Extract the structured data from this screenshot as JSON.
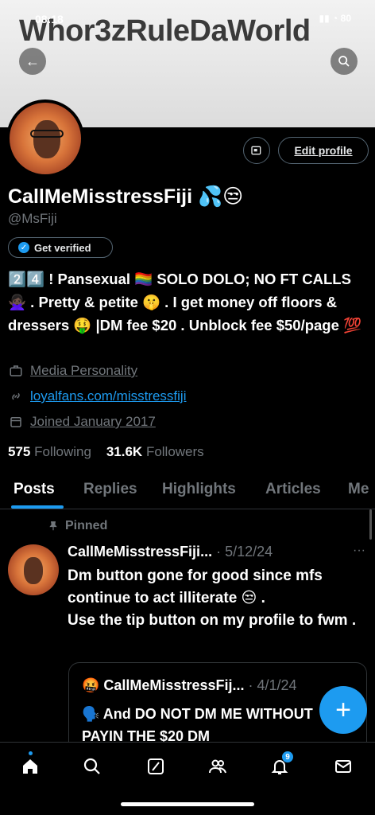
{
  "status": {
    "time": "08:18",
    "icons": "▮▮ ◔ 80"
  },
  "banner": {
    "text": "Whor3zRuleDaWorld"
  },
  "profile": {
    "display_name": "CallMeMisstressFiji 💦😒",
    "handle": "@MsFiji",
    "get_verified": "Get verified",
    "edit_profile": "Edit profile",
    "bio": "2️⃣4️⃣ ! Pansexual 🏳️‍🌈 SOLO DOLO; NO FT CALLS 🙅🏿‍♀️ . Pretty & petite 🤫 . I get money off floors & dressers 🤑 |DM fee $20 . Unblock fee $50/page 💯",
    "category": "Media Personality",
    "website": "loyalfans.com/misstressfiji",
    "joined": "Joined January 2017",
    "following_count": "575",
    "following_label": "Following",
    "followers_count": "31.6K",
    "followers_label": "Followers"
  },
  "tabs": [
    "Posts",
    "Replies",
    "Highlights",
    "Articles",
    "Me"
  ],
  "pinned_label": "Pinned",
  "tweet": {
    "name": "CallMeMisstressFiji...",
    "date": "· 5/12/24",
    "more": "···",
    "line1": "Dm button gone for good since mfs continue to act illiterate 😒 .",
    "line2": "Use the tip button on my profile to fwm .",
    "quote_name": "🤬 CallMeMisstressFij...",
    "quote_date": "· 4/1/24",
    "quote_text": "🗣️ And DO NOT DM ME WITHOUT PAYIN THE $20 DM"
  },
  "fab": "+",
  "nav": {
    "notifications_badge": "9"
  },
  "colors": {
    "accent": "#1d9bf0",
    "background": "#000000",
    "muted": "#71767b"
  }
}
